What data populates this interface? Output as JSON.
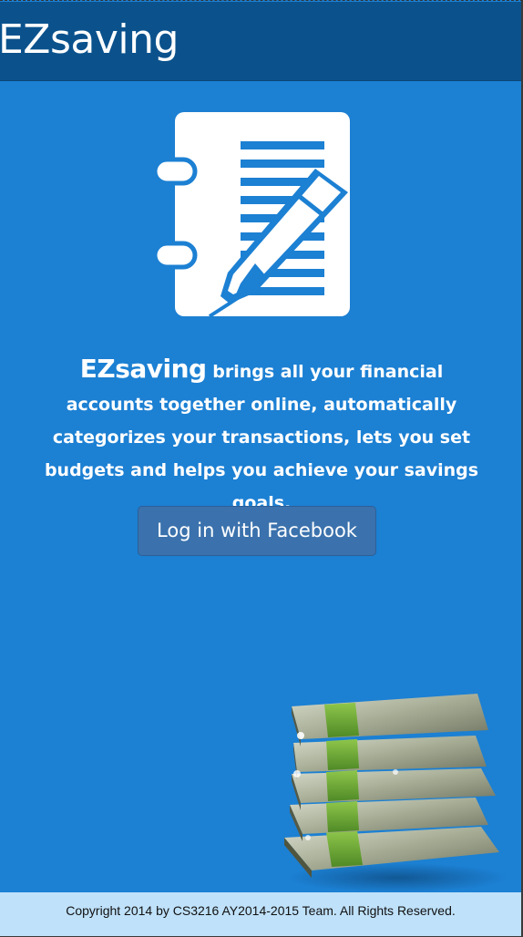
{
  "header": {
    "title": "EZsaving"
  },
  "logo": {
    "icon": "notebook-pen-icon",
    "color": "#ffffff"
  },
  "intro": {
    "brand": "EZsaving",
    "text": "brings all your financial accounts together online, automatically categorizes your transactions, lets you set budgets and helps you achieve your savings goals."
  },
  "login": {
    "facebook_label": "Log in with Facebook"
  },
  "illustration": {
    "name": "money-stack-image"
  },
  "footer": {
    "copyright": "Copyright 2014 by CS3216 AY2014-2015 Team. All Rights Reserved."
  },
  "colors": {
    "header_bg": "#0b528d",
    "page_bg": "#1c80d3",
    "button_bg": "#3b72ad",
    "footer_bg": "#bfe1fa"
  }
}
